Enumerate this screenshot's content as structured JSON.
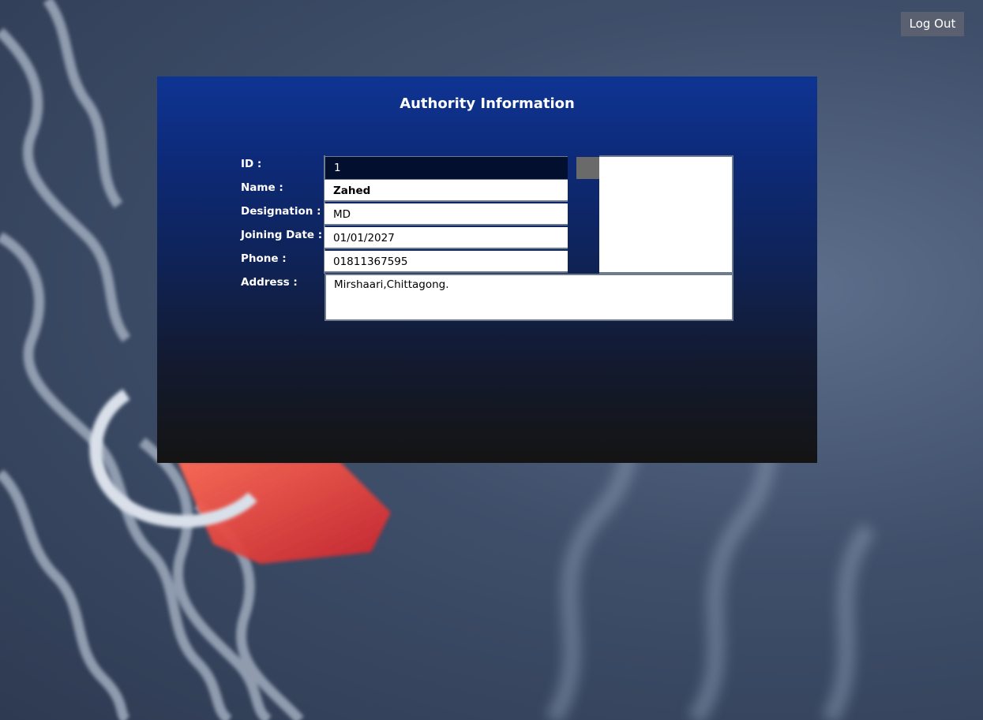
{
  "header": {
    "logout_label": "Log Out"
  },
  "panel": {
    "title": "Authority Information"
  },
  "labels": {
    "id": "ID :",
    "name": "Name :",
    "designation": "Designation :",
    "joining_date": "Joining Date :",
    "phone": "Phone :",
    "address": "Address :"
  },
  "values": {
    "id": "1",
    "name": "Zahed",
    "designation": "MD",
    "joining_date": "01/01/2027",
    "phone": "01811367595",
    "address": "Mirshaari,Chittagong."
  },
  "colors": {
    "panel_top": "#0e3493",
    "panel_bottom": "#141414",
    "logout_bg": "#5b6070"
  }
}
